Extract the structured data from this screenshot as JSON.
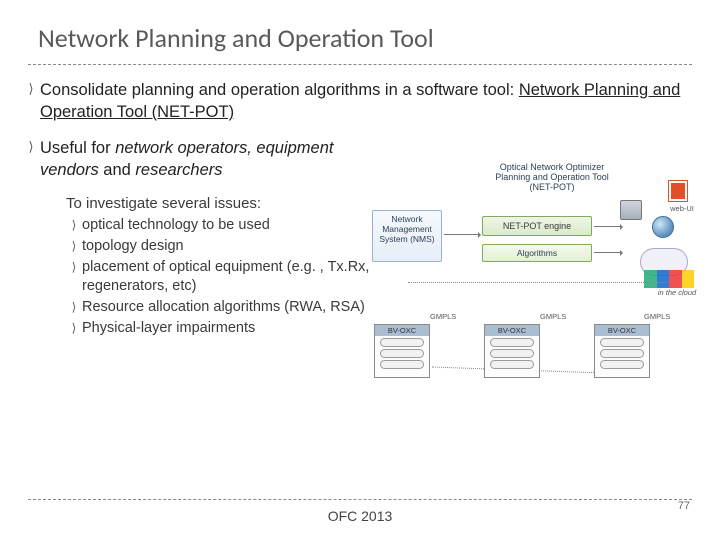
{
  "title": "Network Planning and Operation Tool",
  "bullets": [
    {
      "pre": "Consolidate planning and operation algorithms in a software tool: ",
      "underline": "Network Planning and Operation Tool (NET-POT)"
    },
    {
      "rich": "Useful for <span class='ital'>network operators, equipment vendors</span> and <span class='ital'>researchers</span>"
    }
  ],
  "sub_intro": "To investigate several issues:",
  "sub_items": [
    "optical technology to be used",
    "topology design",
    "placement of optical equipment (e.g. , Tx.Rx, regenerators, etc)",
    "Resource allocation algorithms (RWA, RSA)",
    "Physical-layer impairments"
  ],
  "diagram": {
    "opt_title": "Optical Network Optimizer Planning and Operation Tool (NET-POT)",
    "nms": "Network Management System (NMS)",
    "engine": "NET-POT engine",
    "algos": "Algorithms",
    "node_hdr": "BV-OXC",
    "gmpls": "GMPLS",
    "webui": "web-UI",
    "cloud_note": "in the cloud"
  },
  "footer": "OFC 2013",
  "page": "77"
}
